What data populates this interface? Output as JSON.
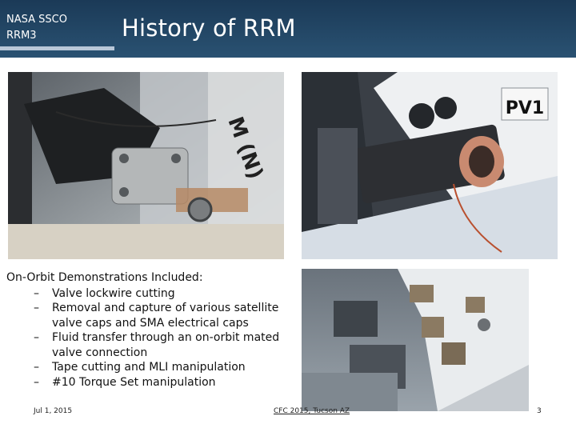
{
  "header": {
    "org_line1": "NASA SSCO",
    "org_line2": "RRM3",
    "title": "History of RRM"
  },
  "photos": {
    "top_left": {
      "visible_text": "M (N)",
      "alt": "Tool gripping valve lockwire"
    },
    "top_right": {
      "visible_text": "PV1",
      "alt": "Fluid transfer tool at valve PV1"
    },
    "bottom_right": {
      "alt": "RRM module exterior with tools"
    }
  },
  "content": {
    "lead": "On-Orbit Demonstrations Included:",
    "items": [
      [
        "Valve lockwire cutting"
      ],
      [
        "Removal and capture of various satellite",
        "valve caps and SMA electrical caps"
      ],
      [
        "Fluid transfer through an on-orbit mated",
        "valve connection"
      ],
      [
        "Tape cutting and MLI manipulation"
      ],
      [
        "#10 Torque Set manipulation"
      ]
    ],
    "dash": "–"
  },
  "footer": {
    "date": "Jul 1, 2015",
    "conference": "CFC 2015, Tucson AZ",
    "page_number": "3"
  },
  "colors": {
    "header_bg": "#234766",
    "accent_bar": "#b8c7d8",
    "text": "#111111"
  }
}
